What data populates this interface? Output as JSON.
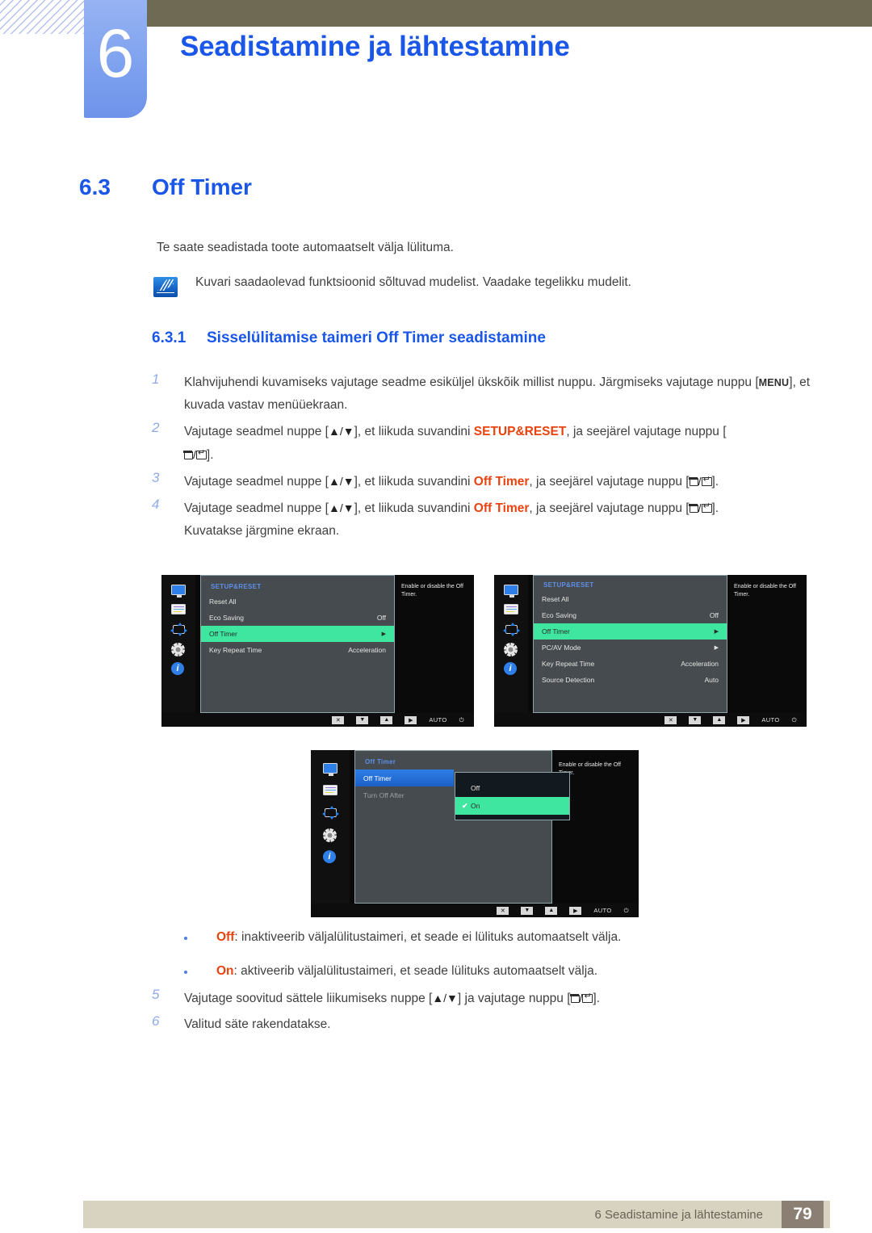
{
  "header": {
    "chapter_number": "6",
    "chapter_title": "Seadistamine ja lähtestamine",
    "accent_blue": "#1a56e8",
    "badge_blue": "#7ea2ef",
    "olive": "#6f6a54"
  },
  "section": {
    "number": "6.3",
    "title": "Off Timer"
  },
  "intro": "Te saate seadistada toote automaatselt välja lülituma.",
  "note": {
    "icon": "note-pen-icon",
    "text": "Kuvari saadaolevad funktsioonid sõltuvad mudelist. Vaadake tegelikku mudelit."
  },
  "subsection": {
    "number": "6.3.1",
    "title": "Sisselülitamise taimeri Off Timer seadistamine"
  },
  "steps": [
    {
      "n": "1",
      "part1": "Klahvijuhendi kuvamiseks vajutage seadme esiküljel ükskõik millist nuppu. Järgmiseks vajutage nuppu [",
      "key": "MENU",
      "part2": "], et kuvada vastav menüüekraan."
    },
    {
      "n": "2",
      "part1": "Vajutage seadmel nuppe [",
      "arrows": "▲/▼",
      "part2": "], et liikuda suvandini ",
      "highlight": "SETUP&RESET",
      "part3": ", ja seejärel vajutage nuppu [",
      "part4": "]."
    },
    {
      "n": "3",
      "part1": "Vajutage seadmel nuppe [",
      "arrows": "▲/▼",
      "part2": "], et liikuda suvandini ",
      "highlight": "Off Timer",
      "part3": ", ja seejärel vajutage nuppu [",
      "part4": "]."
    },
    {
      "n": "4",
      "part1": "Vajutage seadmel nuppe [",
      "arrows": "▲/▼",
      "part2": "], et liikuda suvandini ",
      "highlight": "Off Timer",
      "part3": ", ja seejärel vajutage nuppu [",
      "part4": "].",
      "extra": "Kuvatakse järgmine ekraan."
    }
  ],
  "bullets": [
    {
      "label": "Off",
      "text": ": inaktiveerib väljalülitustaimeri, et seade ei lülituks automaatselt välja."
    },
    {
      "label": "On",
      "text": ": aktiveerib väljalülitustaimeri, et seade lülituks automaatselt välja."
    }
  ],
  "steps_after": [
    {
      "n": "5",
      "part1": "Vajutage soovitud sättele liikumiseks nuppe [",
      "arrows": "▲/▼",
      "part2": "] ja vajutage nuppu [",
      "part3": "]."
    },
    {
      "n": "6",
      "part1": "Valitud säte rakendatakse."
    }
  ],
  "osd": {
    "icon_names": [
      "monitor-icon",
      "picture-list-icon",
      "move-arrows-icon",
      "gear-icon",
      "info-icon"
    ],
    "help_text": "Enable or disable the Off Timer.",
    "footer_buttons": [
      {
        "name": "close-button",
        "glyph": "✕"
      },
      {
        "name": "down-button",
        "glyph": "▼"
      },
      {
        "name": "up-button",
        "glyph": "▲"
      },
      {
        "name": "right-button",
        "glyph": "▶"
      }
    ],
    "footer_auto": "AUTO",
    "footer_power": "⏻",
    "colors": {
      "selected_green": "#3ee6a0",
      "selected_blue": "#2e7fe8",
      "panel": "#454b4e",
      "title_blue": "#5f8fe8"
    },
    "screen1": {
      "title": "SETUP&RESET",
      "rows": [
        {
          "label": "Reset All",
          "value": "",
          "selected": false
        },
        {
          "label": "Eco Saving",
          "value": "Off",
          "selected": false
        },
        {
          "label": "Off Timer",
          "value": "▶",
          "selected": true
        },
        {
          "label": "Key Repeat Time",
          "value": "Acceleration",
          "selected": false
        }
      ]
    },
    "screen2": {
      "title": "SETUP&RESET",
      "rows": [
        {
          "label": "Reset All",
          "value": "",
          "selected": false
        },
        {
          "label": "Eco Saving",
          "value": "Off",
          "selected": false
        },
        {
          "label": "Off Timer",
          "value": "▶",
          "selected": true
        },
        {
          "label": "PC/AV Mode",
          "value": "▶",
          "selected": false
        },
        {
          "label": "Key Repeat Time",
          "value": "Acceleration",
          "selected": false
        },
        {
          "label": "Source Detection",
          "value": "Auto",
          "selected": false
        }
      ]
    },
    "screen3": {
      "title": "Off Timer",
      "rows": [
        {
          "label": "Off Timer",
          "value": "",
          "selected": true
        },
        {
          "label": "Turn Off After",
          "value": "",
          "selected": false
        }
      ],
      "popup": [
        {
          "label": "Off",
          "checked": false,
          "selected": false
        },
        {
          "label": "On",
          "checked": true,
          "selected": true
        }
      ],
      "check_glyph": "✔"
    }
  },
  "footer": {
    "text": "6 Seadistamine ja lähtestamine",
    "page": "79"
  }
}
